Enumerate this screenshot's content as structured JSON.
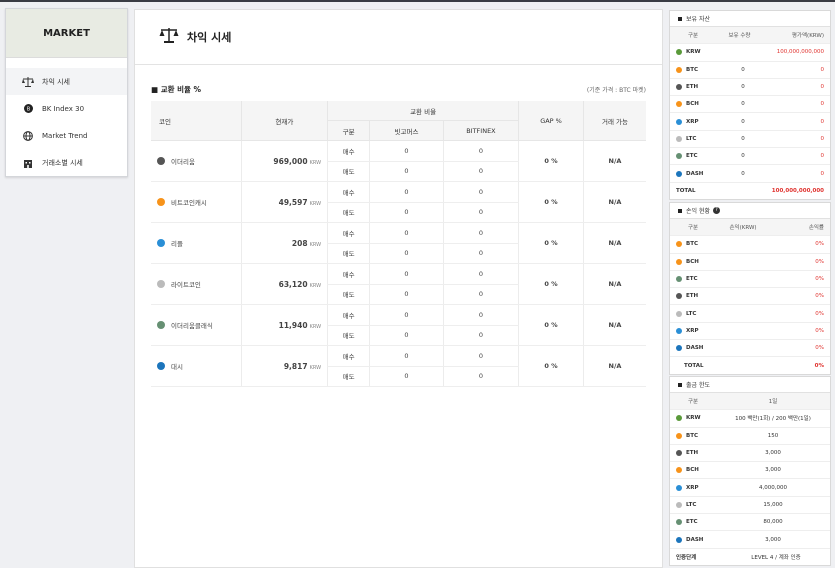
{
  "sidebar": {
    "title": "MARKET",
    "items": [
      {
        "label": "차익 시세",
        "icon": "scale-icon"
      },
      {
        "label": "BK Index 30",
        "icon": "bk-coin-icon"
      },
      {
        "label": "Market Trend",
        "icon": "globe-icon"
      },
      {
        "label": "거래소별 시세",
        "icon": "building-icon"
      }
    ]
  },
  "main": {
    "title": "차익 시세",
    "section_title": "교환 비율 %",
    "section_note": "(기준 가격 : BTC 마켓)",
    "headers": {
      "coin": "코인",
      "price": "현재가",
      "exchange_ratio": "교환 비율",
      "type": "구분",
      "ex1": "빗고머스",
      "ex2": "BITFINEX",
      "gap": "GAP %",
      "tradable": "거래 가능"
    },
    "rows": [
      {
        "name": "이더리움",
        "price": "969,000",
        "unit": "KRW",
        "buy": "매수",
        "sell": "매도",
        "buy_v1": "0",
        "buy_v2": "0",
        "sell_v1": "0",
        "sell_v2": "0",
        "gap": "0 %",
        "tradable": "N/A",
        "color": "#555555"
      },
      {
        "name": "비트코인캐시",
        "price": "49,597",
        "unit": "KRW",
        "buy": "매수",
        "sell": "매도",
        "buy_v1": "0",
        "buy_v2": "0",
        "sell_v1": "0",
        "sell_v2": "0",
        "gap": "0 %",
        "tradable": "N/A",
        "color": "#f7931a"
      },
      {
        "name": "리플",
        "price": "208",
        "unit": "KRW",
        "buy": "매수",
        "sell": "매도",
        "buy_v1": "0",
        "buy_v2": "0",
        "sell_v1": "0",
        "sell_v2": "0",
        "gap": "0 %",
        "tradable": "N/A",
        "color": "#2a8fd6"
      },
      {
        "name": "라이트코인",
        "price": "63,120",
        "unit": "KRW",
        "buy": "매수",
        "sell": "매도",
        "buy_v1": "0",
        "buy_v2": "0",
        "sell_v1": "0",
        "sell_v2": "0",
        "gap": "0 %",
        "tradable": "N/A",
        "color": "#bbbbbb"
      },
      {
        "name": "이더리움클래식",
        "price": "11,940",
        "unit": "KRW",
        "buy": "매수",
        "sell": "매도",
        "buy_v1": "0",
        "buy_v2": "0",
        "sell_v1": "0",
        "sell_v2": "0",
        "gap": "0 %",
        "tradable": "N/A",
        "color": "#669073"
      },
      {
        "name": "대시",
        "price": "9,817",
        "unit": "KRW",
        "buy": "매수",
        "sell": "매도",
        "buy_v1": "0",
        "buy_v2": "0",
        "sell_v1": "0",
        "sell_v2": "0",
        "gap": "0 %",
        "tradable": "N/A",
        "color": "#1c75bc"
      }
    ]
  },
  "holdings": {
    "title": "보유 자산",
    "headers": [
      "구분",
      "보유 수량",
      "평가액(KRW)"
    ],
    "rows": [
      {
        "coin": "KRW",
        "qty": "",
        "value": "100,000,000,000",
        "color": "#5a9a3a"
      },
      {
        "coin": "BTC",
        "qty": "0",
        "value": "0",
        "color": "#f7931a"
      },
      {
        "coin": "ETH",
        "qty": "0",
        "value": "0",
        "color": "#555555"
      },
      {
        "coin": "BCH",
        "qty": "0",
        "value": "0",
        "color": "#f7931a"
      },
      {
        "coin": "XRP",
        "qty": "0",
        "value": "0",
        "color": "#2a8fd6"
      },
      {
        "coin": "LTC",
        "qty": "0",
        "value": "0",
        "color": "#bbbbbb"
      },
      {
        "coin": "ETC",
        "qty": "0",
        "value": "0",
        "color": "#669073"
      },
      {
        "coin": "DASH",
        "qty": "0",
        "value": "0",
        "color": "#1c75bc"
      }
    ],
    "total_label": "TOTAL",
    "total_value": "100,000,000,000"
  },
  "pnl": {
    "title": "손익 현황",
    "badge": "?",
    "headers": [
      "구분",
      "손익(KRW)",
      "손익률"
    ],
    "rows": [
      {
        "coin": "BTC",
        "amount": "",
        "rate": "0%",
        "color": "#f7931a"
      },
      {
        "coin": "BCH",
        "amount": "",
        "rate": "0%",
        "color": "#f7931a"
      },
      {
        "coin": "ETC",
        "amount": "",
        "rate": "0%",
        "color": "#669073"
      },
      {
        "coin": "ETH",
        "amount": "",
        "rate": "0%",
        "color": "#555555"
      },
      {
        "coin": "LTC",
        "amount": "",
        "rate": "0%",
        "color": "#bbbbbb"
      },
      {
        "coin": "XRP",
        "amount": "",
        "rate": "0%",
        "color": "#2a8fd6"
      },
      {
        "coin": "DASH",
        "amount": "",
        "rate": "0%",
        "color": "#1c75bc"
      }
    ],
    "total_label": "TOTAL",
    "total_rate": "0%"
  },
  "withdraw": {
    "title": "출금 한도",
    "headers": [
      "구분",
      "1일"
    ],
    "rows": [
      {
        "coin": "KRW",
        "limit": "100 백만(1회) / 200 백만(1일)",
        "color": "#5a9a3a"
      },
      {
        "coin": "BTC",
        "limit": "150",
        "color": "#f7931a"
      },
      {
        "coin": "ETH",
        "limit": "3,000",
        "color": "#555555"
      },
      {
        "coin": "BCH",
        "limit": "3,000",
        "color": "#f7931a"
      },
      {
        "coin": "XRP",
        "limit": "4,000,000",
        "color": "#2a8fd6"
      },
      {
        "coin": "LTC",
        "limit": "15,000",
        "color": "#bbbbbb"
      },
      {
        "coin": "ETC",
        "limit": "80,000",
        "color": "#669073"
      },
      {
        "coin": "DASH",
        "limit": "3,000",
        "color": "#1c75bc"
      }
    ],
    "auth_label": "인증단계",
    "auth_value": "LEVEL 4 / 계좌 인증"
  }
}
